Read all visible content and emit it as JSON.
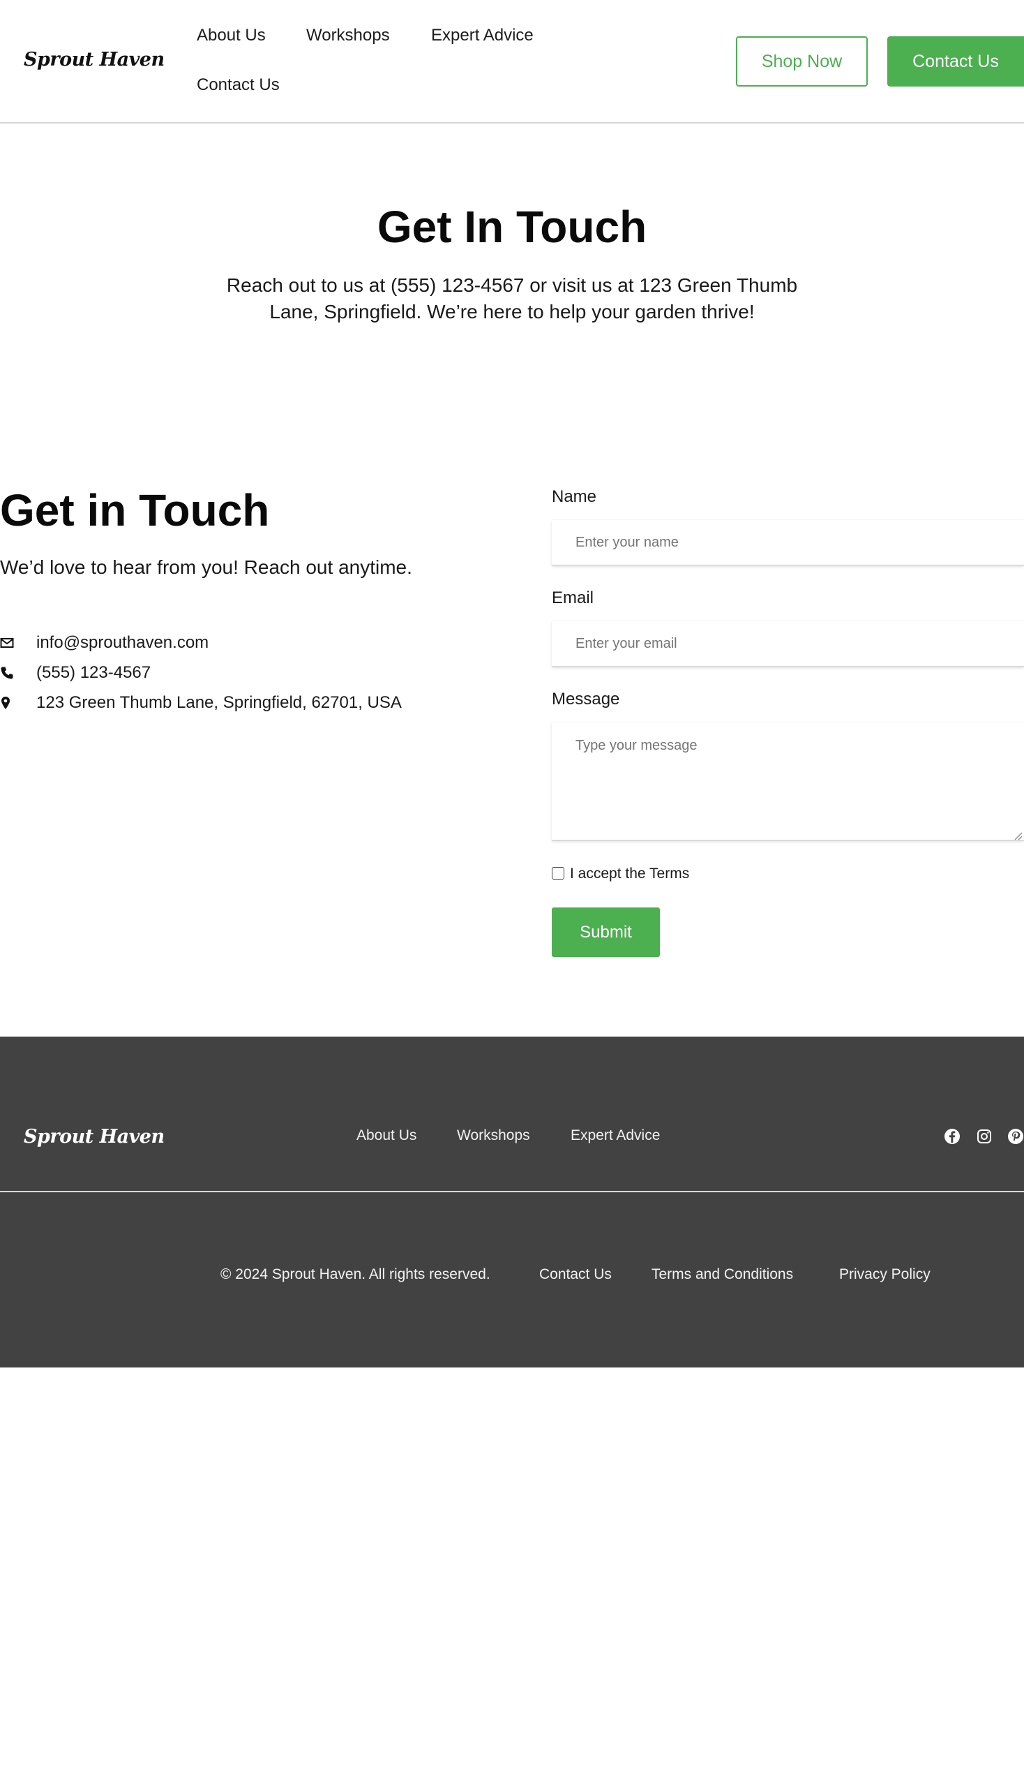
{
  "header": {
    "logo": "Sprout Haven",
    "nav": [
      "About Us",
      "Workshops",
      "Expert Advice",
      "Contact Us"
    ],
    "shop_button": "Shop Now",
    "contact_button": "Contact Us"
  },
  "hero": {
    "title": "Get In Touch",
    "text": "Reach out to us at (555) 123-4567 or visit us at 123 Green Thumb Lane, Springfield. We’re here to help your garden thrive!"
  },
  "contact": {
    "title": "Get in Touch",
    "subtitle": "We’d love to hear from you! Reach out anytime.",
    "email": "info@sprouthaven.com",
    "phone": "(555) 123-4567",
    "address": "123 Green Thumb Lane, Springfield, 62701, USA"
  },
  "form": {
    "name_label": "Name",
    "name_placeholder": "Enter your name",
    "email_label": "Email",
    "email_placeholder": "Enter your email",
    "message_label": "Message",
    "message_placeholder": "Type your message",
    "terms_label": "I accept the Terms",
    "submit_label": "Submit"
  },
  "footer": {
    "logo": "Sprout Haven",
    "nav": [
      "About Us",
      "Workshops",
      "Expert Advice"
    ],
    "social_icons": [
      "facebook-icon",
      "instagram-icon",
      "pinterest-icon"
    ],
    "copyright": "© 2024 Sprout Haven. All rights reserved.",
    "bottom_links": [
      "Contact Us",
      "Terms and Conditions",
      "Privacy Policy"
    ]
  },
  "colors": {
    "accent": "#4caf50",
    "footer_bg": "#424242"
  }
}
